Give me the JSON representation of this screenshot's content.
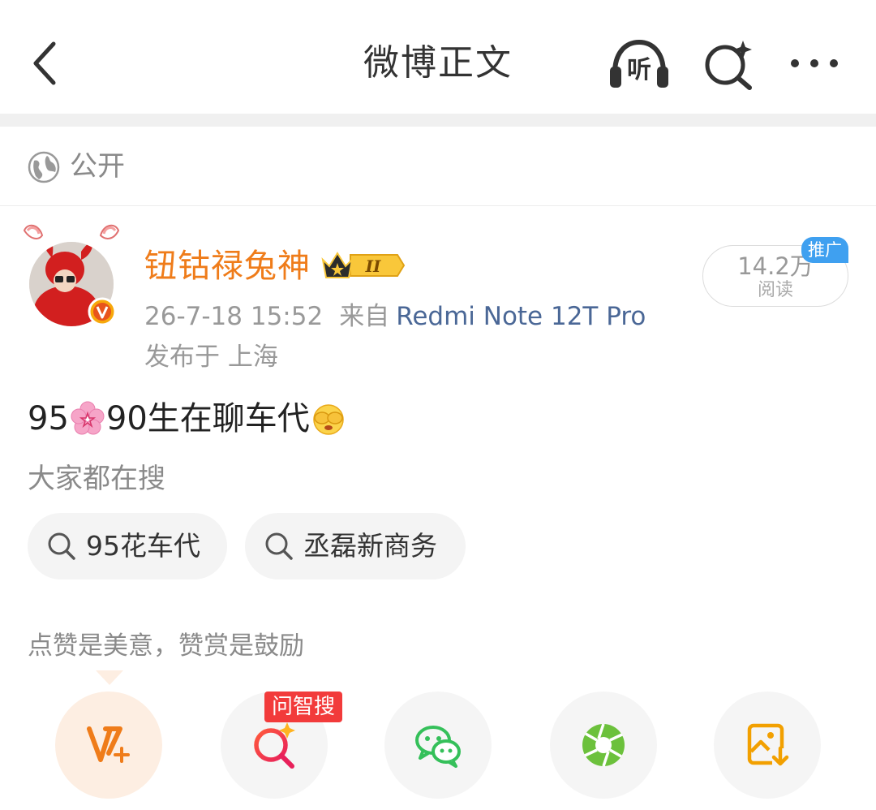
{
  "header": {
    "title": "微博正文",
    "listen_label": "听"
  },
  "visibility": {
    "label": "公开"
  },
  "post": {
    "author": "钮钴禄兔神",
    "member_level": "II",
    "time": "26-7-18 15:52",
    "from_label": "来自",
    "device": "Redmi Note 12T Pro",
    "location": "发布于 上海",
    "reads": "14.2万",
    "reads_label": "阅读",
    "promo_label": "推广",
    "text_part1": "95",
    "text_part2": "90生在聊车代"
  },
  "hot_search": {
    "title": "大家都在搜",
    "chips": [
      {
        "label": "95花车代"
      },
      {
        "label": "丞磊新商务"
      }
    ]
  },
  "reward": {
    "hint": "点赞是美意，赞赏是鼓励",
    "ask_tag": "问智搜"
  },
  "colors": {
    "username": "#ef7c1a",
    "device_link": "#4a6796",
    "promo_tag": "#3fa0f0",
    "ask_tag": "#f23b3b",
    "wechat": "#35c05a",
    "moments": "#6cc13c",
    "save_image": "#f2a000",
    "vplus": "#ef7c1a"
  },
  "icons": {
    "back": "chevron-left-icon",
    "listen": "headphones-icon",
    "search": "sparkle-search-icon",
    "more": "more-dots-icon",
    "visibility": "globe-icon",
    "verified": "verified-v-icon"
  }
}
